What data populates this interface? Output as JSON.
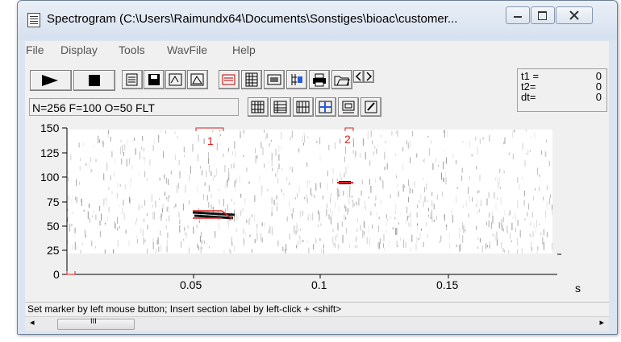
{
  "window": {
    "title": "Spectrogram (C:\\Users\\Raimundx64\\Documents\\Sonstiges\\bioac\\customer..."
  },
  "menu": [
    "File",
    "Display",
    "Tools",
    "WavFile",
    "Help"
  ],
  "toolbar": {
    "play_icon": "play-icon",
    "stop_icon": "stop-icon"
  },
  "info_text": "N=256 F=100 O=50 FLT",
  "time_readout": {
    "t1_label": "t1 =",
    "t1_value": "0",
    "t2_label": "t2=",
    "t2_value": "0",
    "dt_label": "dt=",
    "dt_value": "0"
  },
  "plot": {
    "y_ticks": [
      "150",
      "125",
      "100",
      "75",
      "50",
      "25",
      "0"
    ],
    "x_ticks": [
      "0.05",
      "0.1",
      "0.15"
    ],
    "x_unit": "s",
    "markers": [
      "1",
      "2"
    ]
  },
  "status_text": "Set marker by left mouse button; Insert section label by left-click + <shift>",
  "scrollbar": {
    "left_arrow": "◂",
    "right_arrow": "▸",
    "grip": "III"
  }
}
